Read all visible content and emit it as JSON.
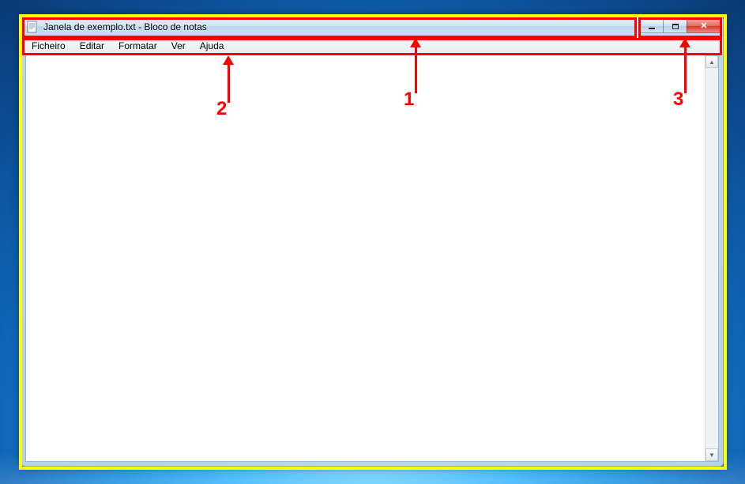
{
  "window": {
    "title": "Janela de exemplo.txt - Bloco de notas"
  },
  "menubar": {
    "items": [
      {
        "label": "Ficheiro"
      },
      {
        "label": "Editar"
      },
      {
        "label": "Formatar"
      },
      {
        "label": "Ver"
      },
      {
        "label": "Ajuda"
      }
    ]
  },
  "editor": {
    "content": ""
  },
  "annotations": {
    "label1": "1",
    "label2": "2",
    "label3": "3"
  }
}
